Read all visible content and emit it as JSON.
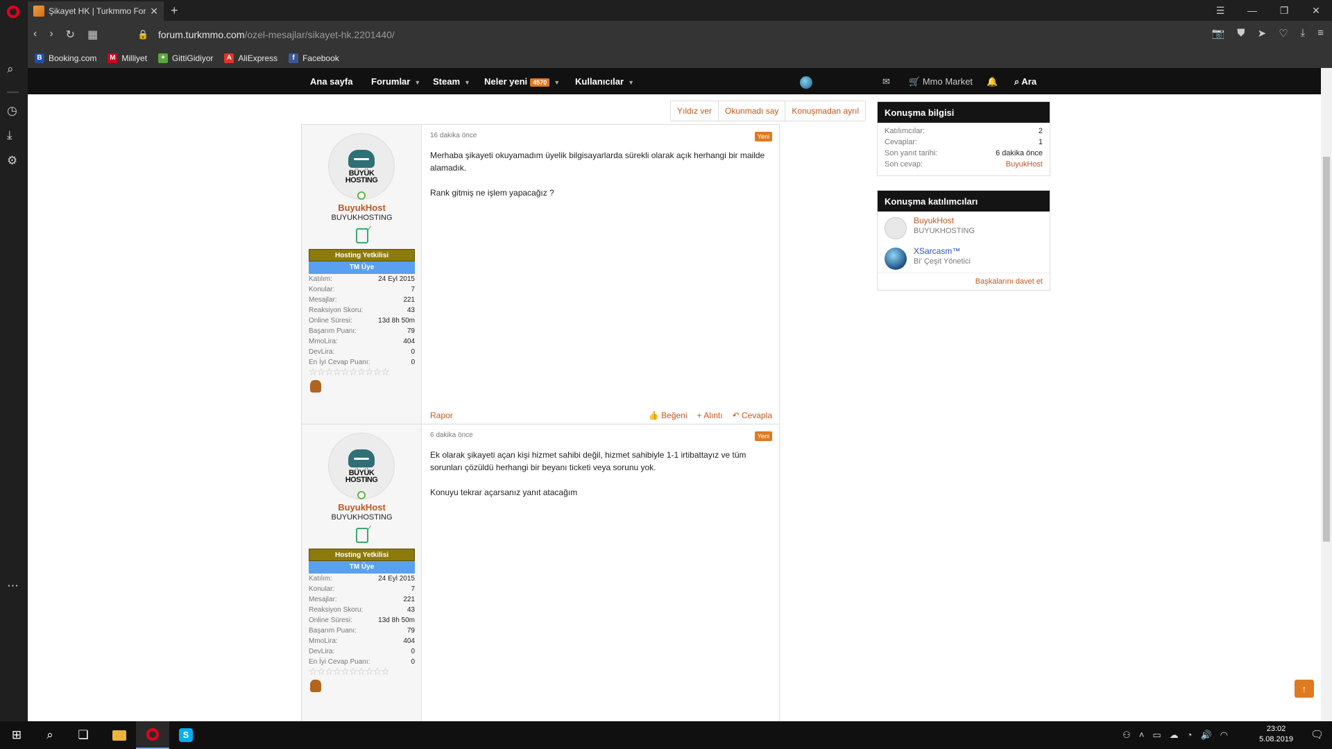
{
  "browser": {
    "tab_title": "Şikayet HK | Turkmmo For",
    "url_domain": "forum.turkmmo.com",
    "url_path": "/ozel-mesajlar/sikayet-hk.2201440/",
    "bookmarks": [
      "Booking.com",
      "Milliyet",
      "GittiGidiyor",
      "AliExpress",
      "Facebook"
    ]
  },
  "nav": {
    "items": [
      "Ana sayfa",
      "Forumlar",
      "Steam",
      "Neler yeni",
      "Kullanıcılar"
    ],
    "new_count": "4570",
    "market": "Mmo Market",
    "search": "Ara"
  },
  "actions": [
    "Yıldız ver",
    "Okunmadı say",
    "Konuşmadan ayrıl"
  ],
  "posts": [
    {
      "time": "16 dakika önce",
      "new_badge": "Yeni",
      "lines": [
        "Merhaba şikayeti okuyamadım üyelik bilgisayarlarda sürekli olarak açık herhangi bir mailde alamadık.",
        "Rank gitmiş ne işlem yapacağız ?"
      ],
      "report": "Rapor",
      "like": "Beğeni",
      "quote": "Alıntı",
      "reply": "Cevapla"
    },
    {
      "time": "6 dakika önce",
      "new_badge": "Yeni",
      "lines": [
        "Ek olarak şikayeti açan kişi hizmet sahibi değil, hizmet sahibiyle 1-1 irtibattayız ve tüm sorunları çözüldü herhangi bir beyanı ticketi veya sorunu yok.",
        "Konuyu tekrar açarsanız yanıt atacağım"
      ]
    }
  ],
  "user": {
    "name": "BuyukHost",
    "title": "BUYUKHOSTING",
    "logo_line1": "BÜYÜK",
    "logo_line2": "HOSTING",
    "banner1": "Hosting Yetkilisi",
    "banner2": "TM Üye",
    "stats": [
      {
        "k": "Katılım:",
        "v": "24 Eyl 2015"
      },
      {
        "k": "Konular:",
        "v": "7"
      },
      {
        "k": "Mesajlar:",
        "v": "221"
      },
      {
        "k": "Reaksiyon Skoru:",
        "v": "43"
      },
      {
        "k": "Online Süresi:",
        "v": "13d 8h 50m"
      },
      {
        "k": "Başarım Puanı:",
        "v": "79"
      },
      {
        "k": "MmoLira:",
        "v": "404"
      },
      {
        "k": "DevLira:",
        "v": "0"
      },
      {
        "k": "En İyi Cevap Puanı:",
        "v": "0"
      }
    ],
    "star_count": 10
  },
  "info_box": {
    "title": "Konuşma bilgisi",
    "rows": [
      {
        "k": "Katılımcılar:",
        "v": "2"
      },
      {
        "k": "Cevaplar:",
        "v": "1"
      },
      {
        "k": "Son yanıt tarihi:",
        "v": "6 dakika önce"
      },
      {
        "k": "Son cevap:",
        "v": "BuyukHost"
      }
    ]
  },
  "participants_box": {
    "title": "Konuşma katılımcıları",
    "members": [
      {
        "name": "BuyukHost",
        "title": "BUYUKHOSTING",
        "color": "#c0571f"
      },
      {
        "name": "XSarcasm™",
        "title": "Bi' Çeşit Yönetici",
        "color": "#2b4ec9"
      }
    ],
    "invite": "Başkalarını davet et"
  },
  "taskbar": {
    "time": "23:02",
    "date": "5.08.2019"
  },
  "colors": {
    "accent": "#c0571f",
    "badge": "#e07a1f",
    "banner_olive": "#8c7a0b",
    "banner_blue": "#5aa0f0"
  }
}
